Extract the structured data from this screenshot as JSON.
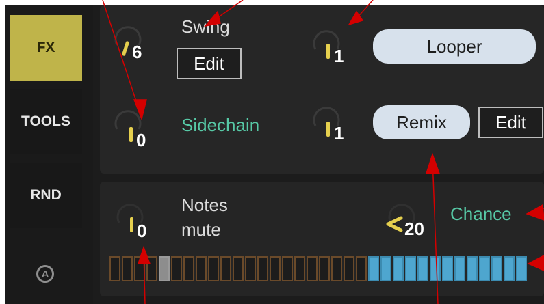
{
  "sidebar": {
    "items": [
      {
        "label": "FX"
      },
      {
        "label": "TOOLS"
      },
      {
        "label": "RND"
      }
    ],
    "logo_icon": "circle-a-icon",
    "active_color": "#bfb44a"
  },
  "top_panel": {
    "swing": {
      "knob_value": "6",
      "label": "Swing",
      "edit_label": "Edit"
    },
    "looper": {
      "knob_value": "1",
      "label": "Looper"
    },
    "sidechain": {
      "knob_value": "0",
      "label": "Sidechain"
    },
    "remix": {
      "knob_value": "1",
      "label": "Remix",
      "edit_label": "Edit"
    }
  },
  "bottom_panel": {
    "notes_mute": {
      "knob_value": "0",
      "label_line1": "Notes",
      "label_line2": "mute"
    },
    "chance": {
      "knob_value": "20",
      "label": "Chance"
    },
    "step_colors": {
      "off": "#6a4a2a",
      "current": "#8d8d8d",
      "on": "#4ea6cf"
    },
    "steps_total": 34,
    "current_step": 5,
    "first_on_step": 22
  },
  "colors": {
    "accent_yellow": "#e6d04e",
    "accent_green": "#57c9a6",
    "annotation_red": "#d40000"
  }
}
